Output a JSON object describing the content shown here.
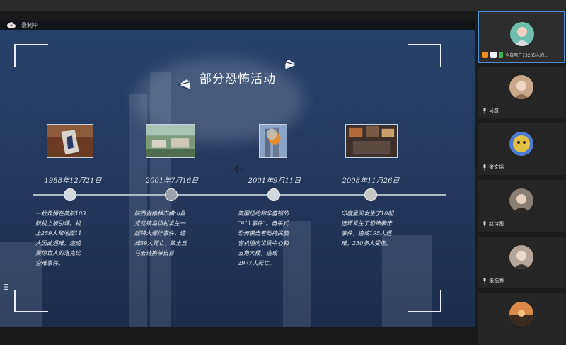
{
  "recording": {
    "label": "录制中"
  },
  "slide": {
    "title": "部分恐怖活动",
    "events": [
      {
        "date": "1988年12月21日",
        "description": "一枚炸弹在美航103\n航机上被引爆。机\n上259人和地面11\n人因此遇难，造成\n震惊世人的洛克比\n空难事件。",
        "image_icon": "photo-lockerbie"
      },
      {
        "date": "2001年7月16日",
        "description": "陕西省榆林市横山县\n党岔镇马坊村发生一\n起特大爆炸事件，造\n成89人死亡，致土丘\n马宏诗携带自首",
        "image_icon": "photo-village"
      },
      {
        "date": "2001年9月11日",
        "description": "美国纽约和华盛顿的\n“911事件”。自杀式\n恐怖袭击者劫持民航\n客机撞向世贸中心和\n五角大楼，造成\n2977人死亡。",
        "image_icon": "photo-wtc"
      },
      {
        "date": "2008年11月26日",
        "description": "印度孟买发生了10起\n连环发生了恐怖袭击\n事件，造成195人遇\n难，250多人受伤。",
        "image_icon": "photo-mumbai"
      }
    ]
  },
  "participants": [
    {
      "name": "全自用户73205人的...",
      "active": true,
      "avatar_color": "#6fbfae",
      "controls_label": "全自用户73205人的..."
    },
    {
      "name": "马忽",
      "avatar_color": "#c9a98a"
    },
    {
      "name": "张文锦",
      "avatar_color": "#e0c247"
    },
    {
      "name": "赵诗画",
      "avatar_color": "#8a7f74"
    },
    {
      "name": "张浩腾",
      "avatar_color": "#b4a69a"
    },
    {
      "name": "",
      "avatar_color": "#d98a4a"
    }
  ]
}
